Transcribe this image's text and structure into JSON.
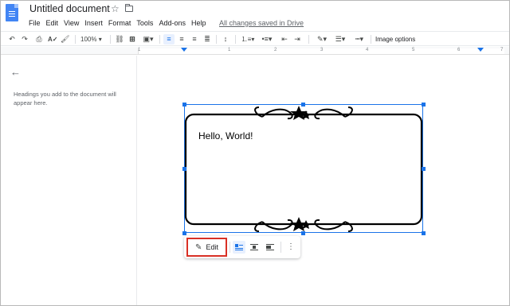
{
  "header": {
    "title": "Untitled document",
    "saved_status": "All changes saved in Drive"
  },
  "menu": [
    "File",
    "Edit",
    "View",
    "Insert",
    "Format",
    "Tools",
    "Add-ons",
    "Help"
  ],
  "toolbar": {
    "zoom": "100%",
    "image_options_label": "Image options"
  },
  "ruler": {
    "numbers": [
      "1",
      "1",
      "2",
      "3",
      "4",
      "5",
      "6",
      "7"
    ]
  },
  "outline": {
    "empty_message": "Headings you add to the document will appear here."
  },
  "document": {
    "drawing_text": "Hello, World!"
  },
  "image_toolbar": {
    "edit_label": "Edit"
  },
  "colors": {
    "accent": "#1a73e8",
    "highlight": "#d93025",
    "docs_blue": "#4285f4"
  }
}
